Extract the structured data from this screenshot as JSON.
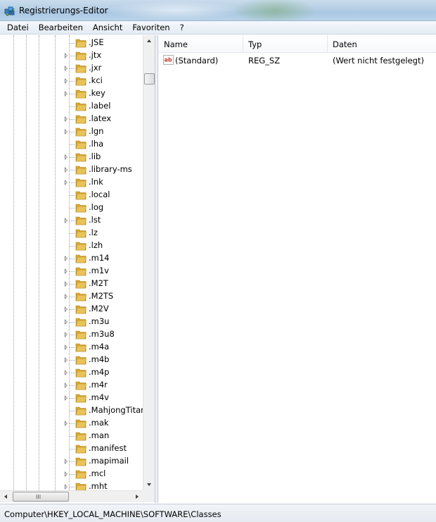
{
  "window": {
    "title": "Registrierungs-Editor"
  },
  "menu": [
    "Datei",
    "Bearbeiten",
    "Ansicht",
    "Favoriten",
    "?"
  ],
  "tree": {
    "items": [
      {
        "label": ".JSE",
        "expandable": false
      },
      {
        "label": ".jtx",
        "expandable": true
      },
      {
        "label": ".jxr",
        "expandable": true
      },
      {
        "label": ".kci",
        "expandable": true
      },
      {
        "label": ".key",
        "expandable": true
      },
      {
        "label": ".label",
        "expandable": false
      },
      {
        "label": ".latex",
        "expandable": true
      },
      {
        "label": ".lgn",
        "expandable": true
      },
      {
        "label": ".lha",
        "expandable": false
      },
      {
        "label": ".lib",
        "expandable": true
      },
      {
        "label": ".library-ms",
        "expandable": true
      },
      {
        "label": ".lnk",
        "expandable": true
      },
      {
        "label": ".local",
        "expandable": false
      },
      {
        "label": ".log",
        "expandable": false
      },
      {
        "label": ".lst",
        "expandable": true
      },
      {
        "label": ".lz",
        "expandable": false
      },
      {
        "label": ".lzh",
        "expandable": false
      },
      {
        "label": ".m14",
        "expandable": true
      },
      {
        "label": ".m1v",
        "expandable": true
      },
      {
        "label": ".M2T",
        "expandable": true
      },
      {
        "label": ".M2TS",
        "expandable": true
      },
      {
        "label": ".M2V",
        "expandable": true
      },
      {
        "label": ".m3u",
        "expandable": true
      },
      {
        "label": ".m3u8",
        "expandable": true
      },
      {
        "label": ".m4a",
        "expandable": true
      },
      {
        "label": ".m4b",
        "expandable": true
      },
      {
        "label": ".m4p",
        "expandable": true
      },
      {
        "label": ".m4r",
        "expandable": true
      },
      {
        "label": ".m4v",
        "expandable": true
      },
      {
        "label": ".MahjongTitan",
        "expandable": false
      },
      {
        "label": ".mak",
        "expandable": true
      },
      {
        "label": ".man",
        "expandable": false
      },
      {
        "label": ".manifest",
        "expandable": false
      },
      {
        "label": ".mapimail",
        "expandable": true
      },
      {
        "label": ".mcl",
        "expandable": true
      },
      {
        "label": ".mht",
        "expandable": true
      }
    ],
    "hscroll_grip": "III"
  },
  "list": {
    "columns": [
      "Name",
      "Typ",
      "Daten"
    ],
    "rows": [
      {
        "name": "(Standard)",
        "type": "REG_SZ",
        "data": "(Wert nicht festgelegt)",
        "icon": "string-value-icon"
      }
    ]
  },
  "status": {
    "path": "Computer\\HKEY_LOCAL_MACHINE\\SOFTWARE\\Classes"
  },
  "colors": {
    "folder": "#e8c35a",
    "titlebar": "#b7d0e6",
    "accent": "#c0392b"
  }
}
